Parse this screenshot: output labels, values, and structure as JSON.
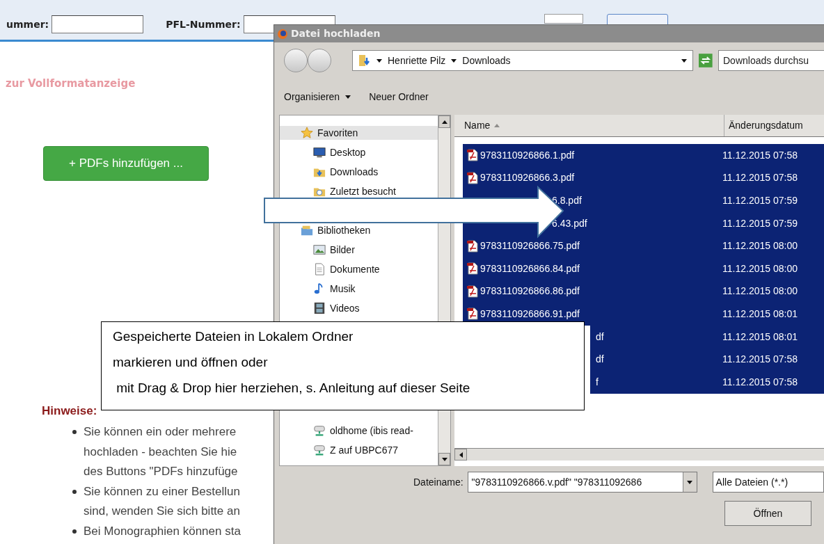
{
  "page": {
    "top_bar": {
      "fields": [
        {
          "label": "ummer:"
        },
        {
          "label": "PFL-Nummer:"
        }
      ]
    },
    "full_view_link": "zur Vollformatanzeige",
    "add_button": "+ PDFs hinzufügen ...",
    "hints": {
      "title": "Hinweise:",
      "items": [
        {
          "lines": [
            "Sie können ein oder mehrere",
            "hochladen - beachten Sie hie",
            "des Buttons \"PDFs hinzufüge"
          ]
        },
        {
          "lines": [
            "Sie können zu einer Bestellun",
            "sind, wenden Sie sich bitte an"
          ]
        },
        {
          "lines": [
            "Bei Monographien können sta"
          ]
        }
      ]
    }
  },
  "dialog": {
    "title": "Datei hochladen",
    "breadcrumb": [
      "Henriette Pilz",
      "Downloads"
    ],
    "search": {
      "placeholder": "Downloads durchsu"
    },
    "toolbar": [
      {
        "label": "Organisieren",
        "kind": "menu"
      },
      {
        "label": "Neuer Ordner",
        "kind": "button"
      }
    ],
    "nav_groups": [
      {
        "items": [
          {
            "label": "Favoriten",
            "kind": "favorites",
            "selected": true
          },
          {
            "label": "Desktop",
            "kind": "desktop",
            "selected": false
          },
          {
            "label": "Downloads",
            "kind": "downloads",
            "selected": false
          },
          {
            "label": "Zuletzt besucht",
            "kind": "recent",
            "selected": false
          }
        ]
      },
      {
        "items": [
          {
            "label": "Bibliotheken",
            "kind": "libraries",
            "selected": false
          },
          {
            "label": "Bilder",
            "kind": "pictures",
            "selected": false
          },
          {
            "label": "Dokumente",
            "kind": "documents",
            "selected": false
          },
          {
            "label": "Musik",
            "kind": "music",
            "selected": false
          },
          {
            "label": "Videos",
            "kind": "videos",
            "selected": false
          }
        ]
      },
      {
        "items": [
          {
            "label": "oldhome (ibis read-",
            "kind": "network",
            "selected": false
          },
          {
            "label": "Z auf UBPC677",
            "kind": "network",
            "selected": false
          }
        ]
      }
    ],
    "columns": [
      "Name",
      "Änderungsdatum"
    ],
    "files": [
      {
        "name": "9783110926866.1.pdf",
        "date": "11.12.2015 07:58",
        "selected": true,
        "kind": "full"
      },
      {
        "name": "9783110926866.3.pdf",
        "date": "11.12.2015 07:58",
        "selected": true,
        "kind": "full"
      },
      {
        "name": "6.8.pdf",
        "date": "11.12.2015 07:59",
        "selected": true,
        "kind": "under_arrow"
      },
      {
        "name": "6.43.pdf",
        "date": "11.12.2015 07:59",
        "selected": true,
        "kind": "under_arrow"
      },
      {
        "name": "9783110926866.75.pdf",
        "date": "11.12.2015 08:00",
        "selected": true,
        "kind": "full"
      },
      {
        "name": "9783110926866.84.pdf",
        "date": "11.12.2015 08:00",
        "selected": true,
        "kind": "full"
      },
      {
        "name": "9783110926866.86.pdf",
        "date": "11.12.2015 08:00",
        "selected": true,
        "kind": "full"
      },
      {
        "name": "9783110926866.91.pdf",
        "date": "11.12.2015 08:01",
        "selected": true,
        "kind": "full"
      },
      {
        "name": "df",
        "date": "11.12.2015 08:01",
        "selected": true,
        "kind": "under_callout"
      },
      {
        "name": "df",
        "date": "11.12.2015 07:58",
        "selected": true,
        "kind": "under_callout"
      },
      {
        "name": "f",
        "date": "11.12.2015 07:58",
        "selected": true,
        "kind": "under_callout"
      }
    ],
    "file_name": {
      "label": "Dateiname:",
      "value": "\"9783110926866.v.pdf\" \"978311092686"
    },
    "filter": "Alle Dateien (*.*)",
    "open_button": "Öffnen"
  },
  "callout": {
    "lines": [
      "Gespeicherte Dateien in Lokalem Ordner",
      "markieren und öffnen oder",
      " mit Drag & Drop hier herziehen, s. Anleitung auf dieser Seite"
    ]
  }
}
